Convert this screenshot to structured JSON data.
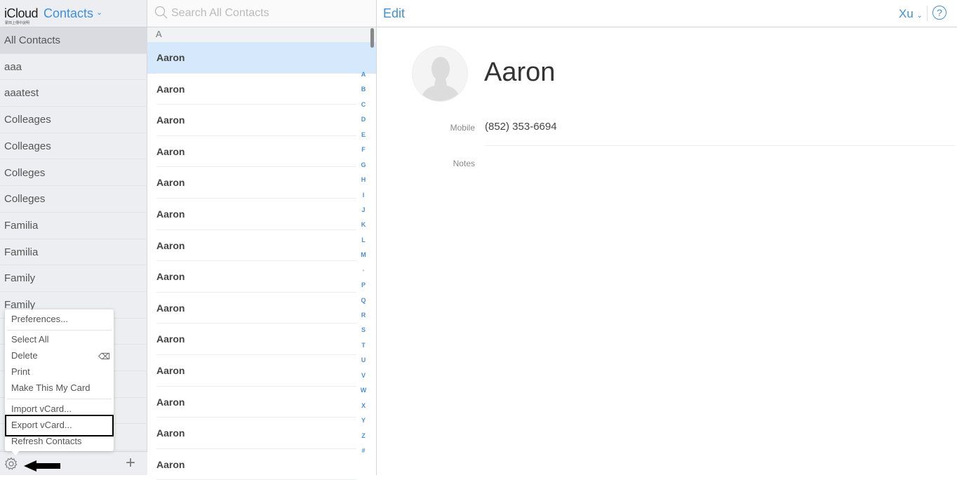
{
  "brand": {
    "icloud": "iCloud",
    "app": "Contacts",
    "subtitle": "蒙田上傳中說明"
  },
  "sidebar": {
    "groups": [
      "All Contacts",
      "aaa",
      "aaatest",
      "Colleages",
      "Colleages",
      "Colleges",
      "Colleges",
      "Familia",
      "Familia",
      "Family",
      "Family",
      "",
      "",
      "",
      "",
      ""
    ],
    "selected": "All Contacts"
  },
  "menu": {
    "items": [
      "Preferences...",
      "Select All",
      "Delete",
      "Print",
      "Make This My Card",
      "Import vCard...",
      "Export vCard...",
      "Refresh Contacts"
    ],
    "highlighted": "Export vCard..."
  },
  "search": {
    "placeholder": "Search All Contacts",
    "value": ""
  },
  "list": {
    "section": "A",
    "contacts": [
      "Aaron",
      "Aaron",
      "Aaron",
      "Aaron",
      "Aaron",
      "Aaron",
      "Aaron",
      "Aaron",
      "Aaron",
      "Aaron",
      "Aaron",
      "Aaron",
      "Aaron",
      "Aaron"
    ],
    "index": [
      "A",
      "B",
      "C",
      "D",
      "E",
      "F",
      "G",
      "H",
      "I",
      "J",
      "K",
      "L",
      "M",
      "•",
      "P",
      "Q",
      "R",
      "S",
      "T",
      "U",
      "V",
      "W",
      "X",
      "Y",
      "Z",
      "#"
    ]
  },
  "detail": {
    "edit": "Edit",
    "user": "Xu",
    "help": "?",
    "name": "Aaron",
    "mobile_label": "Mobile",
    "mobile": "(852) 353-6694",
    "notes_label": "Notes"
  },
  "colors": {
    "accent": "#3f8fde",
    "selected_row": "#d6e8fb"
  },
  "icons": {
    "settings": "gear-icon",
    "add": "plus-icon",
    "search": "search-icon",
    "arrow": "arrow-left-icon"
  }
}
